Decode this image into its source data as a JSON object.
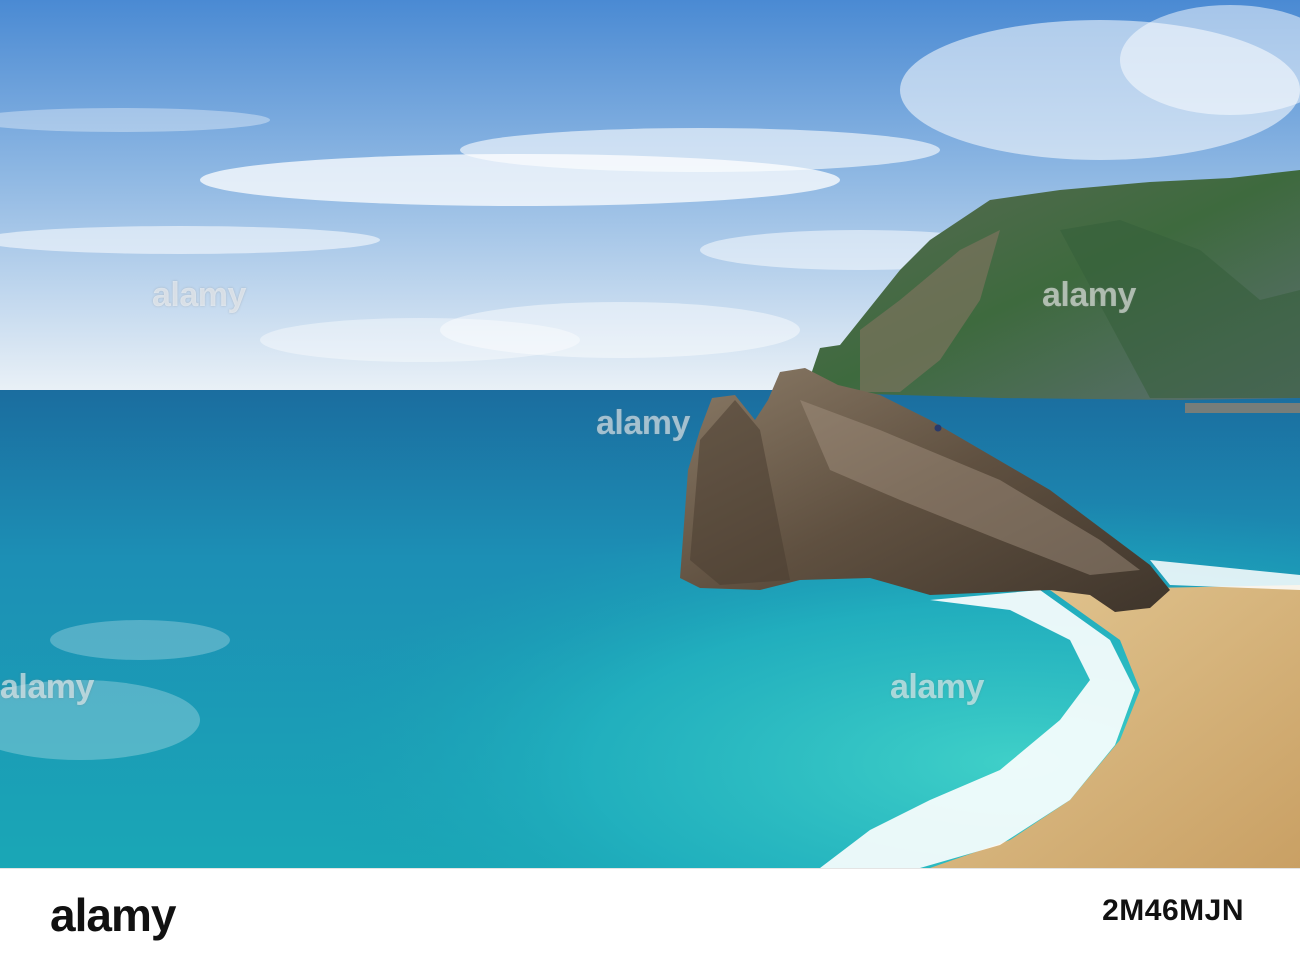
{
  "watermark": {
    "text": "alamy"
  },
  "footer": {
    "logo": "alamy",
    "image_id": "2M46MJN"
  },
  "palette": {
    "sky_top": "#4f8fd6",
    "sky_bottom": "#e9f0f6",
    "sea_deep": "#1f6f9e",
    "sea_turquoise": "#25b7c4",
    "sand": "#d9b77a",
    "rock": "#6b5a48",
    "hill_green": "#3f6a3c"
  }
}
